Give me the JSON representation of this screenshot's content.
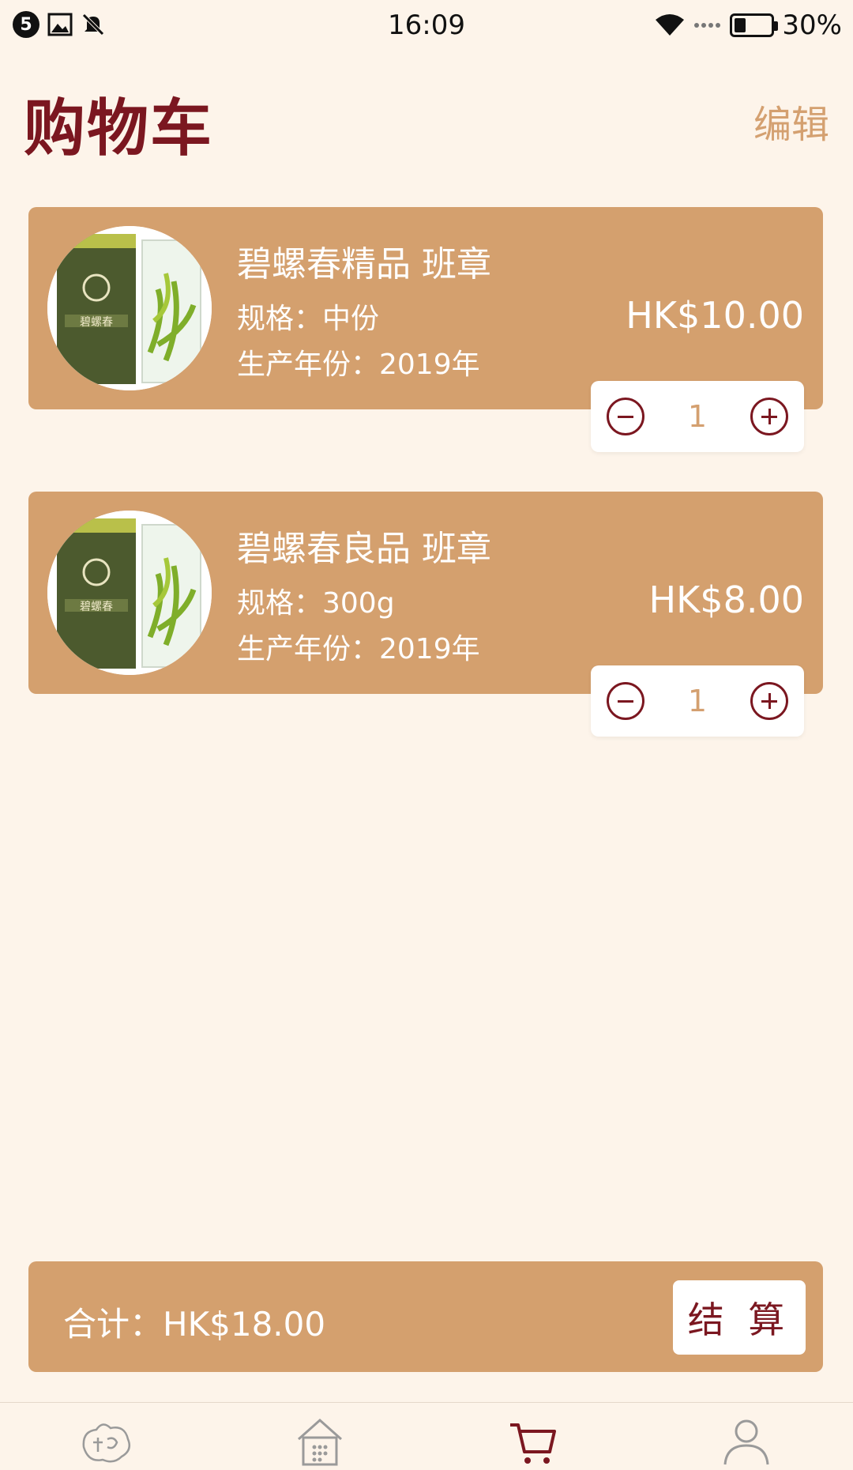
{
  "status_bar": {
    "notification_count": "5",
    "time": "16:09",
    "battery_percent": "30%",
    "battery_level": 0.3
  },
  "header": {
    "title": "购物车",
    "edit_label": "编辑"
  },
  "cart": {
    "items": [
      {
        "name": "碧螺春精品 班章",
        "spec": "规格：中份",
        "year": "生产年份：2019年",
        "price": "HK$10.00",
        "quantity": "1",
        "thumb_icon": "tea-product-image"
      },
      {
        "name": "碧螺春良品 班章",
        "spec": "规格：300g",
        "year": "生产年份：2019年",
        "price": "HK$8.00",
        "quantity": "1",
        "thumb_icon": "tea-product-image"
      }
    ]
  },
  "footer": {
    "total_label": "合计：HK$18.00",
    "checkout_label": "结 算"
  },
  "nav": {
    "items": [
      {
        "icon": "logo-icon",
        "active": false
      },
      {
        "icon": "home-icon",
        "active": false
      },
      {
        "icon": "cart-icon",
        "active": true
      },
      {
        "icon": "profile-icon",
        "active": false
      }
    ]
  },
  "colors": {
    "background": "#fdf4ea",
    "card": "#d4a06e",
    "accent": "#7b1720",
    "muted_accent": "#d4a070",
    "nav_inactive": "#9a9a9a"
  }
}
